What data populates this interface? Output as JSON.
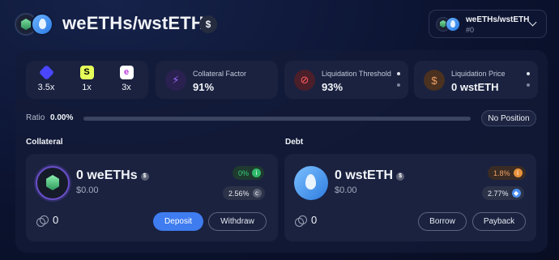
{
  "header": {
    "title": "weETHs/wstETH",
    "currency_symbol": "$",
    "market_selector": {
      "name": "weETHs/wstETH",
      "sub": "#0"
    }
  },
  "multipliers": [
    {
      "icon": "renzo-icon",
      "value": "3.5x"
    },
    {
      "icon": "symbiotic-icon",
      "value": "1x"
    },
    {
      "icon": "etherfi-icon",
      "value": "3x"
    }
  ],
  "stats": {
    "collateral_factor": {
      "label": "Collateral Factor",
      "value": "91%",
      "icon": "lightning-icon"
    },
    "liquidation_threshold": {
      "label": "Liquidation Threshold",
      "value": "93%",
      "icon": "prohibited-icon"
    },
    "liquidation_price": {
      "label": "Liquidation Price",
      "value": "0 wstETH",
      "icon": "dollar-icon"
    }
  },
  "ratio": {
    "label": "Ratio",
    "value": "0.00%",
    "status": "No Position"
  },
  "collateral": {
    "section_label": "Collateral",
    "amount": "0 weETHs",
    "amount_badge": "$",
    "usd": "$0.00",
    "apy_pill": "0%",
    "apy_pill_icon": "i",
    "rate_pill": "2.56%",
    "rate_pill_icon": "c",
    "coins_value": "0",
    "deposit_label": "Deposit",
    "withdraw_label": "Withdraw"
  },
  "debt": {
    "section_label": "Debt",
    "amount": "0 wstETH",
    "amount_badge": "$",
    "usd": "$0.00",
    "apy_pill": "1.8%",
    "apy_pill_icon": "i",
    "rate_pill": "2.77%",
    "rate_pill_icon": "◆",
    "coins_value": "0",
    "borrow_label": "Borrow",
    "payback_label": "Payback"
  },
  "colors": {
    "accent": "#3e7cf0",
    "collateral_factor_icon": "#7a4fe0",
    "liquidation_threshold_icon": "#e04a4a",
    "liquidation_price_icon": "#e8923c",
    "positive": "#35d27a"
  }
}
